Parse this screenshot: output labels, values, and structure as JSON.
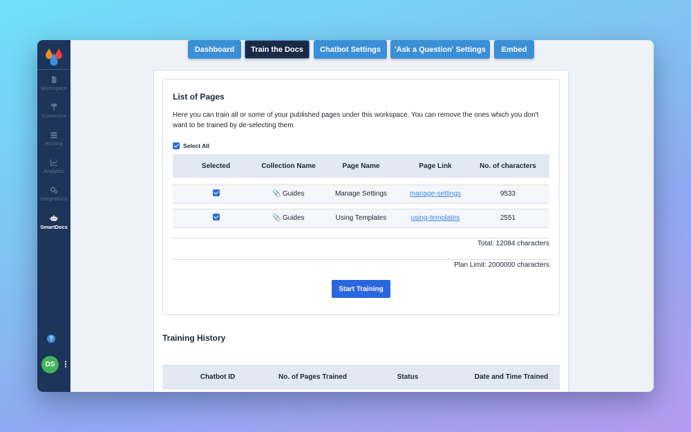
{
  "nav": {
    "tabs": [
      {
        "label": "Dashboard"
      },
      {
        "label": "Train the Docs"
      },
      {
        "label": "Chatbot Settings"
      },
      {
        "label": "'Ask a Question' Settings"
      },
      {
        "label": "Embed"
      }
    ],
    "active_tab": "Train the Docs"
  },
  "sidebar": {
    "items": [
      {
        "label": "Workspace",
        "icon": "document-icon"
      },
      {
        "label": "Customize",
        "icon": "paint-roller-icon"
      },
      {
        "label": "Hosting",
        "icon": "server-icon"
      },
      {
        "label": "Analytics",
        "icon": "chart-line-icon"
      },
      {
        "label": "Integrations",
        "icon": "gears-icon"
      },
      {
        "label": "SmartDocs",
        "icon": "robot-icon"
      }
    ],
    "help_icon": "?",
    "avatar_initials": "DS"
  },
  "pages": {
    "title": "List of Pages",
    "description": "Here you can train all or some of your published pages under this workspace. You can remove the ones which you don't want to be trained by de-selecting them.",
    "select_all_label": "Select All",
    "columns": [
      "Selected",
      "Collection Name",
      "Page Name",
      "Page Link",
      "No. of characters"
    ],
    "rows": [
      {
        "selected": true,
        "collection": "Guides",
        "page_name": "Manage Settings",
        "page_link": "manage-settings",
        "characters": "9533"
      },
      {
        "selected": true,
        "collection": "Guides",
        "page_name": "Using Templates",
        "page_link": "using-templates",
        "characters": "2551"
      }
    ],
    "total_text": "Total: 12084 characters",
    "plan_limit_text": "Plan Limit: 2000000 characters",
    "start_button": "Start Training"
  },
  "history": {
    "title": "Training History",
    "columns": [
      "Chatbot ID",
      "No. of Pages Trained",
      "Status",
      "Date and Time Trained"
    ]
  },
  "colors": {
    "sidebar": "#1d3559",
    "tab": "#3a8fd6",
    "tab_active": "#1a2a44",
    "primary_button": "#2a66e0",
    "link": "#3d86d9",
    "avatar": "#43b35a"
  }
}
